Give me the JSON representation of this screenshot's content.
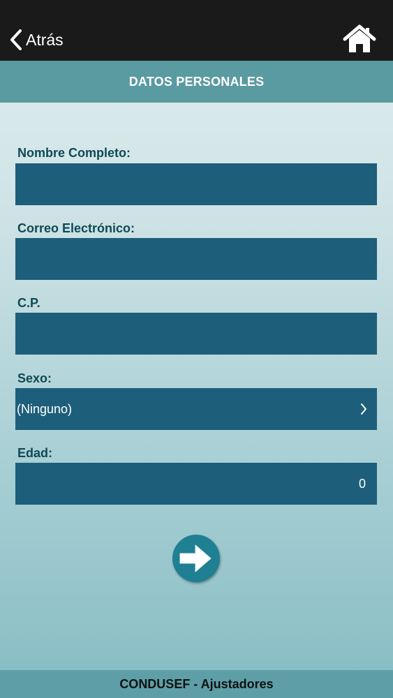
{
  "nav": {
    "back_label": "Atrás",
    "back_icon": "chevron-left-icon",
    "home_icon": "home-icon"
  },
  "header": {
    "title": "DATOS PERSONALES"
  },
  "form": {
    "nombre": {
      "label": "Nombre Completo:",
      "value": ""
    },
    "correo": {
      "label": "Correo Electrónico:",
      "value": ""
    },
    "cp": {
      "label": "C.P.",
      "value": ""
    },
    "sexo": {
      "label": "Sexo:",
      "value": "(Ninguno)"
    },
    "edad": {
      "label": "Edad:",
      "value": "0"
    }
  },
  "next_icon": "arrow-right-icon",
  "footer": {
    "text": "CONDUSEF - Ajustadores"
  },
  "colors": {
    "navbar": "#1a1a1a",
    "header_band": "#5a9aa1",
    "field_fill": "#1d5f7a",
    "label_text": "#0d4a55",
    "next_button": "#1f7f93",
    "footer_band": "#5e9fa7"
  }
}
